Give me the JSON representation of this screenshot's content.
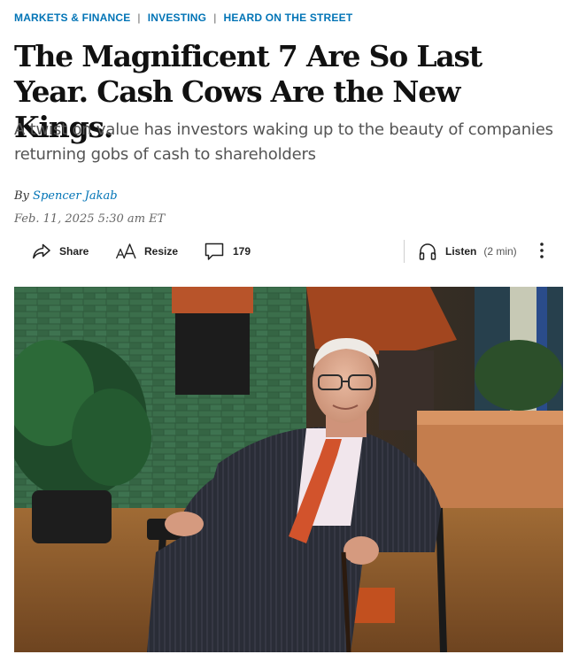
{
  "breadcrumb": {
    "items": [
      "MARKETS & FINANCE",
      "INVESTING",
      "HEARD ON THE STREET"
    ],
    "separator": "|"
  },
  "article": {
    "headline": "The Magnificent 7 Are So Last Year. Cash Cows Are the New Kings.",
    "dek": "A twist on value has investors waking up to the beauty of companies returning gobs of cash to shareholders",
    "byline_prefix": "By",
    "author": "Spencer Jakab",
    "date": "Feb. 11, 2025 5:30 am ET"
  },
  "toolbar": {
    "share_label": "Share",
    "resize_label": "Resize",
    "comments_count": "179",
    "listen_label": "Listen",
    "listen_duration": "(2 min)"
  },
  "icons": {
    "share": "share-arrow-icon",
    "resize": "text-resize-icon",
    "comments": "comment-bubble-icon",
    "listen": "headphones-icon",
    "more": "more-vertical-icon"
  },
  "colors": {
    "link": "#0274b6",
    "text": "#111111",
    "dek": "#555555",
    "divider": "#cfcfcf"
  }
}
